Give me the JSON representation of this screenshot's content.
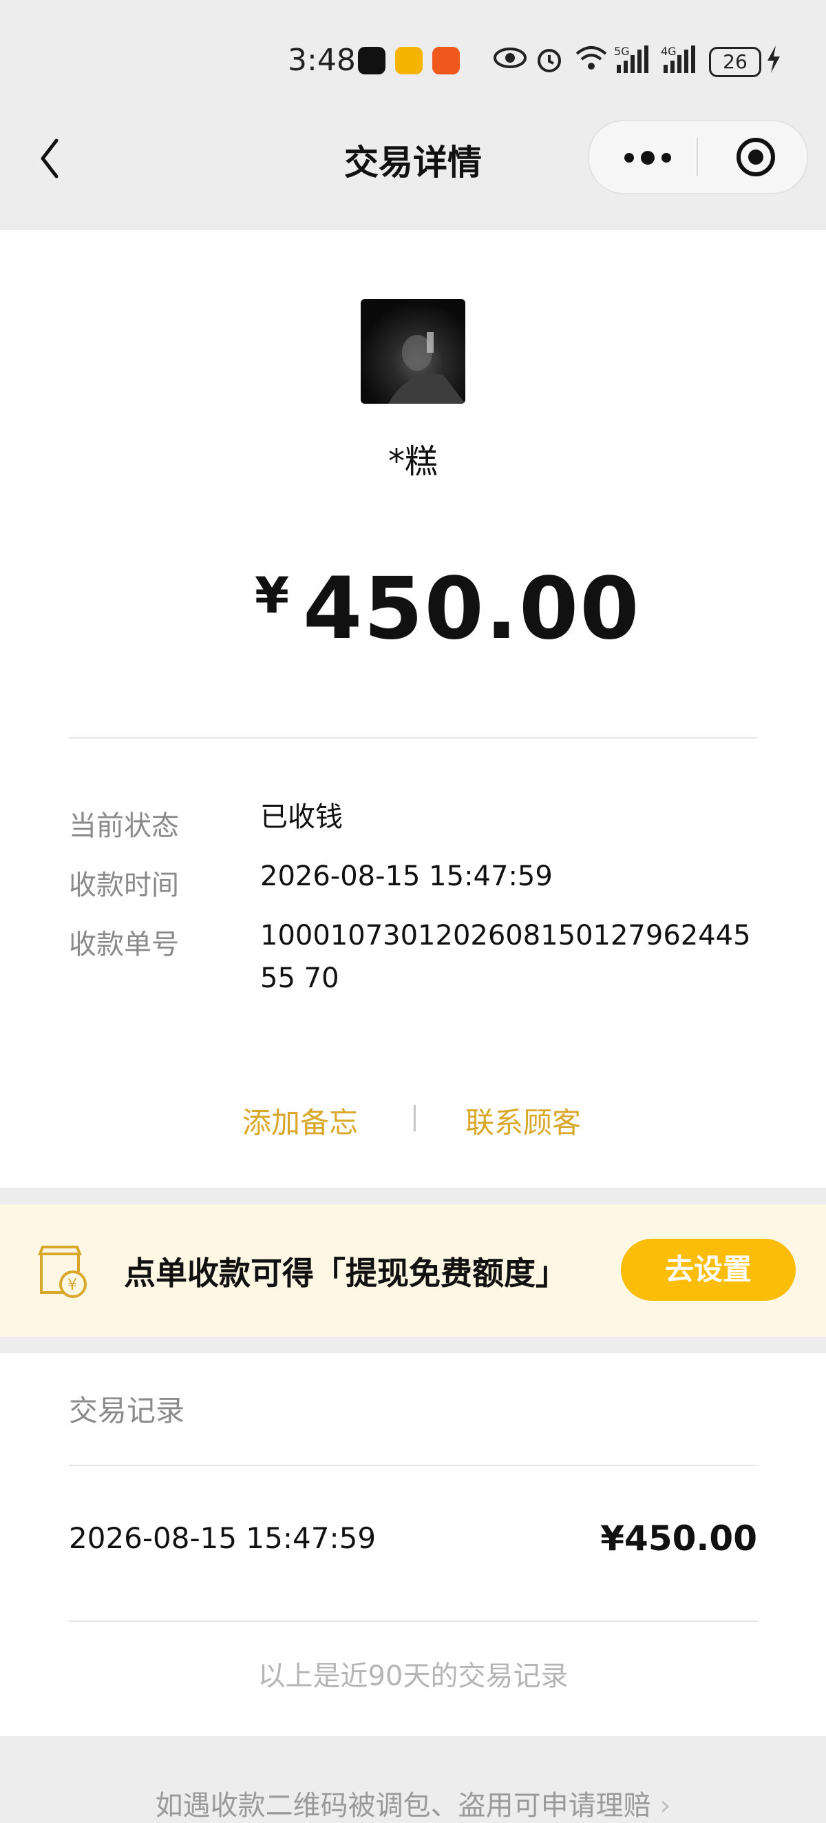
{
  "status_bar": {
    "time": "3:48",
    "signal_5g": "5G",
    "signal_4g": "4G",
    "battery": "26"
  },
  "nav": {
    "title": "交易详情"
  },
  "payer": {
    "name": "*糕"
  },
  "amount": {
    "currency": "¥",
    "value": "450.00"
  },
  "details": [
    {
      "label": "当前状态",
      "value": "已收钱"
    },
    {
      "label": "收款时间",
      "value": "2026-08-15 15:47:59"
    },
    {
      "label": "收款单号",
      "value": "100010730120260815012796244555 70"
    }
  ],
  "actions": {
    "add_note": "添加备忘",
    "separator": "|",
    "contact_customer": "联系顾客"
  },
  "promo": {
    "text": "点单收款可得「提现免费额度」",
    "button": "去设置"
  },
  "records": {
    "title": "交易记录",
    "items": [
      {
        "time": "2026-08-15 15:47:59",
        "amount": "¥450.00"
      }
    ],
    "note": "以上是近90天的交易记录"
  },
  "footer": {
    "link": "如遇收款二维码被调包、盗用可申请理赔",
    "chevron": "›"
  },
  "colors": {
    "accent_link": "#d9a72a",
    "button_yellow": "#fbbd08",
    "promo_bg": "#fdf7e3"
  }
}
